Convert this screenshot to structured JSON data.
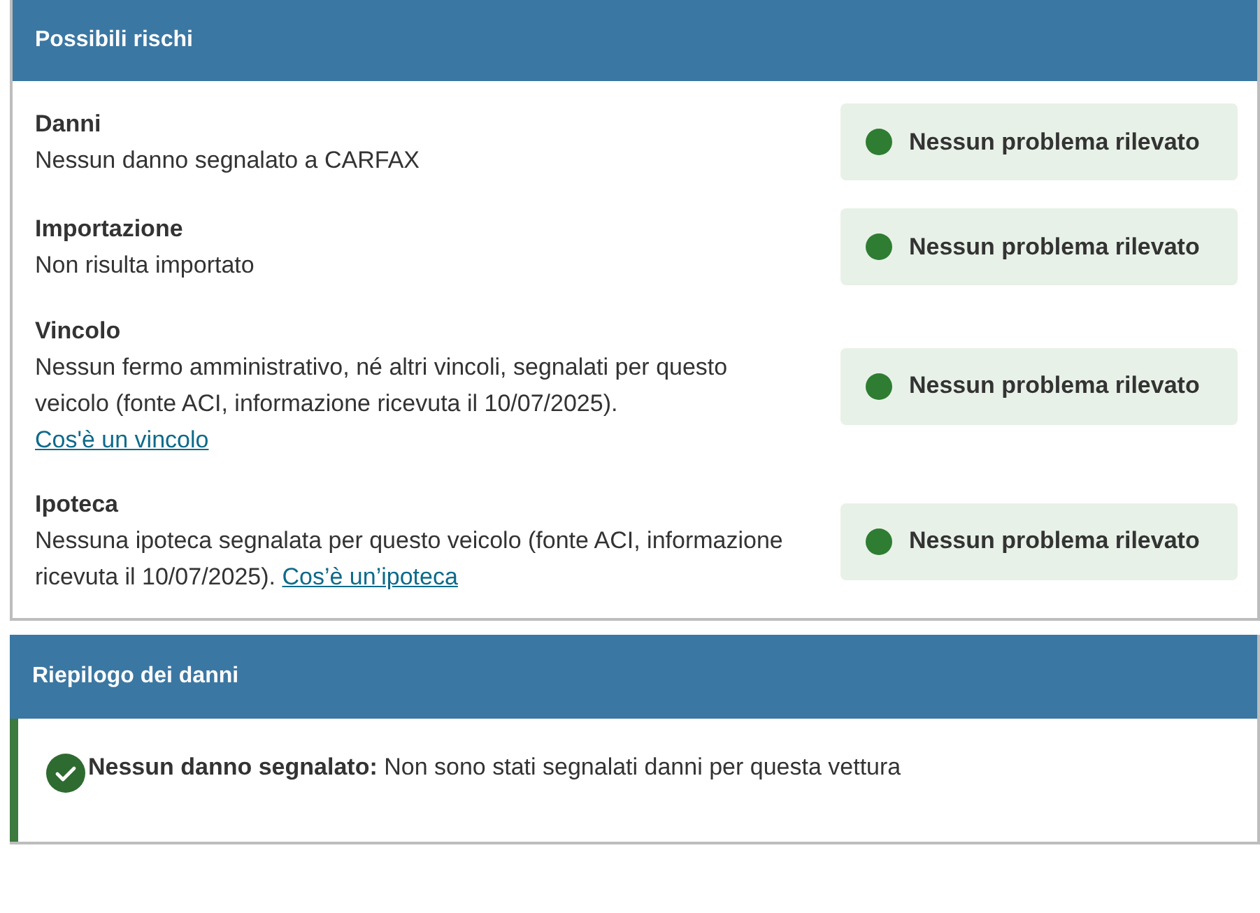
{
  "risks_panel": {
    "title": "Possibili rischi",
    "rows": [
      {
        "title": "Danni",
        "description": "Nessun danno segnalato a CARFAX",
        "status": "Nessun problema rilevato",
        "color": "#2e7d32"
      },
      {
        "title": "Importazione",
        "description": "Non risulta importato",
        "status": "Nessun problema rilevato",
        "color": "#2e7d32"
      },
      {
        "title": "Vincolo",
        "description": "Nessun fermo amministrativo, né altri vincoli, segnalati per questo veicolo (fonte ACI, informazione ricevuta il 10/07/2025).",
        "link": "Cos'è un vincolo",
        "link_on_new_line": true,
        "status": "Nessun problema rilevato",
        "color": "#2e7d32"
      },
      {
        "title": "Ipoteca",
        "description": "Nessuna ipoteca segnalata per questo veicolo (fonte ACI, informazione ricevuta il 10/07/2025).",
        "link": "Cos’è un’ipoteca",
        "link_on_new_line": false,
        "status": "Nessun problema rilevato",
        "color": "#2e7d32"
      }
    ]
  },
  "damage_summary": {
    "title": "Riepilogo dei danni",
    "message": "**Nessun danno segnalato:** Non sono stati segnalati danni per questa vettura"
  }
}
